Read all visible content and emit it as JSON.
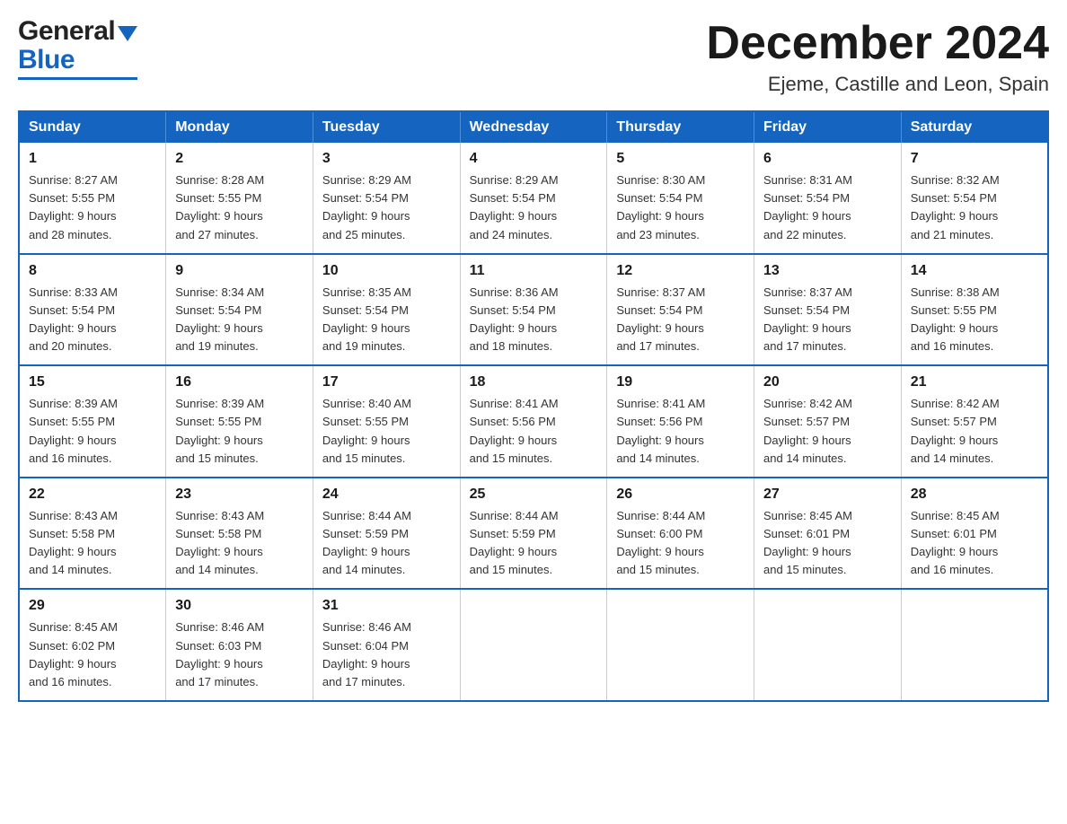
{
  "header": {
    "logo_general": "General",
    "logo_blue": "Blue",
    "month_title": "December 2024",
    "location": "Ejeme, Castille and Leon, Spain"
  },
  "days_of_week": [
    "Sunday",
    "Monday",
    "Tuesday",
    "Wednesday",
    "Thursday",
    "Friday",
    "Saturday"
  ],
  "weeks": [
    [
      {
        "day": "1",
        "sunrise": "8:27 AM",
        "sunset": "5:55 PM",
        "daylight": "9 hours and 28 minutes."
      },
      {
        "day": "2",
        "sunrise": "8:28 AM",
        "sunset": "5:55 PM",
        "daylight": "9 hours and 27 minutes."
      },
      {
        "day": "3",
        "sunrise": "8:29 AM",
        "sunset": "5:54 PM",
        "daylight": "9 hours and 25 minutes."
      },
      {
        "day": "4",
        "sunrise": "8:29 AM",
        "sunset": "5:54 PM",
        "daylight": "9 hours and 24 minutes."
      },
      {
        "day": "5",
        "sunrise": "8:30 AM",
        "sunset": "5:54 PM",
        "daylight": "9 hours and 23 minutes."
      },
      {
        "day": "6",
        "sunrise": "8:31 AM",
        "sunset": "5:54 PM",
        "daylight": "9 hours and 22 minutes."
      },
      {
        "day": "7",
        "sunrise": "8:32 AM",
        "sunset": "5:54 PM",
        "daylight": "9 hours and 21 minutes."
      }
    ],
    [
      {
        "day": "8",
        "sunrise": "8:33 AM",
        "sunset": "5:54 PM",
        "daylight": "9 hours and 20 minutes."
      },
      {
        "day": "9",
        "sunrise": "8:34 AM",
        "sunset": "5:54 PM",
        "daylight": "9 hours and 19 minutes."
      },
      {
        "day": "10",
        "sunrise": "8:35 AM",
        "sunset": "5:54 PM",
        "daylight": "9 hours and 19 minutes."
      },
      {
        "day": "11",
        "sunrise": "8:36 AM",
        "sunset": "5:54 PM",
        "daylight": "9 hours and 18 minutes."
      },
      {
        "day": "12",
        "sunrise": "8:37 AM",
        "sunset": "5:54 PM",
        "daylight": "9 hours and 17 minutes."
      },
      {
        "day": "13",
        "sunrise": "8:37 AM",
        "sunset": "5:54 PM",
        "daylight": "9 hours and 17 minutes."
      },
      {
        "day": "14",
        "sunrise": "8:38 AM",
        "sunset": "5:55 PM",
        "daylight": "9 hours and 16 minutes."
      }
    ],
    [
      {
        "day": "15",
        "sunrise": "8:39 AM",
        "sunset": "5:55 PM",
        "daylight": "9 hours and 16 minutes."
      },
      {
        "day": "16",
        "sunrise": "8:39 AM",
        "sunset": "5:55 PM",
        "daylight": "9 hours and 15 minutes."
      },
      {
        "day": "17",
        "sunrise": "8:40 AM",
        "sunset": "5:55 PM",
        "daylight": "9 hours and 15 minutes."
      },
      {
        "day": "18",
        "sunrise": "8:41 AM",
        "sunset": "5:56 PM",
        "daylight": "9 hours and 15 minutes."
      },
      {
        "day": "19",
        "sunrise": "8:41 AM",
        "sunset": "5:56 PM",
        "daylight": "9 hours and 14 minutes."
      },
      {
        "day": "20",
        "sunrise": "8:42 AM",
        "sunset": "5:57 PM",
        "daylight": "9 hours and 14 minutes."
      },
      {
        "day": "21",
        "sunrise": "8:42 AM",
        "sunset": "5:57 PM",
        "daylight": "9 hours and 14 minutes."
      }
    ],
    [
      {
        "day": "22",
        "sunrise": "8:43 AM",
        "sunset": "5:58 PM",
        "daylight": "9 hours and 14 minutes."
      },
      {
        "day": "23",
        "sunrise": "8:43 AM",
        "sunset": "5:58 PM",
        "daylight": "9 hours and 14 minutes."
      },
      {
        "day": "24",
        "sunrise": "8:44 AM",
        "sunset": "5:59 PM",
        "daylight": "9 hours and 14 minutes."
      },
      {
        "day": "25",
        "sunrise": "8:44 AM",
        "sunset": "5:59 PM",
        "daylight": "9 hours and 15 minutes."
      },
      {
        "day": "26",
        "sunrise": "8:44 AM",
        "sunset": "6:00 PM",
        "daylight": "9 hours and 15 minutes."
      },
      {
        "day": "27",
        "sunrise": "8:45 AM",
        "sunset": "6:01 PM",
        "daylight": "9 hours and 15 minutes."
      },
      {
        "day": "28",
        "sunrise": "8:45 AM",
        "sunset": "6:01 PM",
        "daylight": "9 hours and 16 minutes."
      }
    ],
    [
      {
        "day": "29",
        "sunrise": "8:45 AM",
        "sunset": "6:02 PM",
        "daylight": "9 hours and 16 minutes."
      },
      {
        "day": "30",
        "sunrise": "8:46 AM",
        "sunset": "6:03 PM",
        "daylight": "9 hours and 17 minutes."
      },
      {
        "day": "31",
        "sunrise": "8:46 AM",
        "sunset": "6:04 PM",
        "daylight": "9 hours and 17 minutes."
      },
      null,
      null,
      null,
      null
    ]
  ],
  "labels": {
    "sunrise": "Sunrise:",
    "sunset": "Sunset:",
    "daylight": "Daylight:"
  }
}
